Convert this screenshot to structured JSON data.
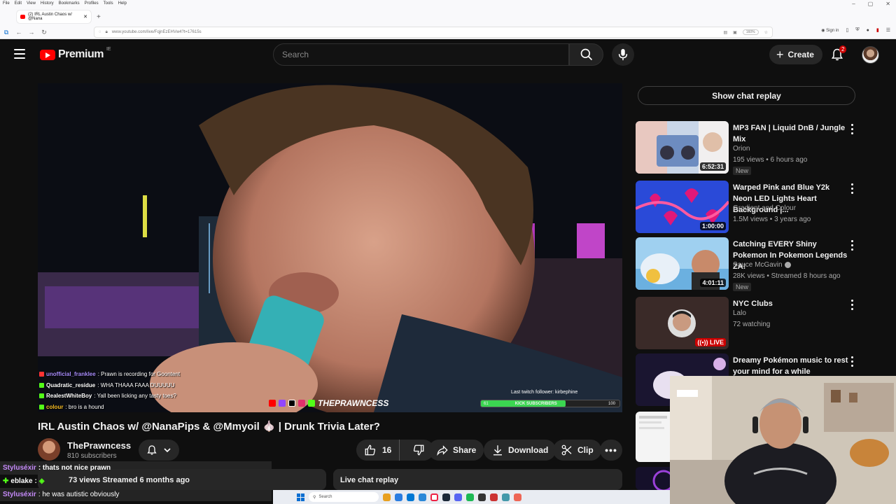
{
  "browser": {
    "menu": [
      "File",
      "Edit",
      "View",
      "History",
      "Bookmarks",
      "Profiles",
      "Tools",
      "Help"
    ],
    "tab_title": "(2) IRL Austin Chaos w/ @Nana",
    "url": "www.youtube.com/live/FqjnEzEHVw4?t=17615s",
    "zoom": "160%",
    "signin": "Sign in"
  },
  "header": {
    "logo_text": "Premium",
    "country": "IE",
    "search_placeholder": "Search",
    "create_label": "Create",
    "notif_count": "2"
  },
  "player": {
    "chat_overlay": [
      {
        "user": "unofficial_franklee",
        "msg": ": Prawn is recording for Goontent"
      },
      {
        "user": "Quadratic_residue",
        "msg": ": WHA THAAA FAAA DUUUUU"
      },
      {
        "user": "RealestWhiteBoy",
        "msg": ": Yall been licking any tasty toes?"
      },
      {
        "user": "colour",
        "msg": ": bro is a hound"
      }
    ],
    "brand": "THEPRAWNCESS",
    "follower_text": "Last twitch follower: kirbephine",
    "sub_bar": {
      "left": "61",
      "label": "KICK SUBSCRIBERS",
      "right": "100",
      "progress": 0.61
    }
  },
  "video": {
    "title": "IRL Austin Chaos w/ @NanaPips & @Mmyoil 🧄 | Drunk Trivia Later?",
    "channel": "ThePrawncess",
    "subscribers": "810 subscribers",
    "likes": "16",
    "share": "Share",
    "download": "Download",
    "clip": "Clip",
    "meta": "73 views  Streamed 6 months ago",
    "live_chat_replay": "Live chat replay"
  },
  "obs_chat": [
    {
      "user": "Styluséxir",
      "msg": ": thats not nice prawn"
    },
    {
      "user": "eblake",
      "msg": ":"
    },
    {
      "user": "Styluséxir",
      "msg": ": he was autistic obviously"
    }
  ],
  "sidebar": {
    "show_chat": "Show chat replay",
    "items": [
      {
        "title": "MP3 FAN | Liquid DnB / Jungle Mix",
        "channel": "Orion",
        "stats": "195 views • 6 hours ago",
        "badge": "New",
        "duration": "6:52:31"
      },
      {
        "title": "Warped Pink and Blue Y2k Neon LED Lights Heart Background |...",
        "channel": "Gradient and Colour",
        "stats": "1.5M views • 3 years ago",
        "duration": "1:00:00"
      },
      {
        "title": "Catching EVERY Shiny Pokemon In Pokemon Legends ZA!",
        "channel": "Sauce McGavin",
        "stats": "28K views • Streamed 8 hours ago",
        "badge": "New",
        "duration": "4:01:11"
      },
      {
        "title": "NYC Clubs",
        "channel": "Lalo",
        "stats": "72 watching",
        "live": "LIVE"
      },
      {
        "title": "Dreamy Pokémon music to rest your mind for a while"
      }
    ]
  },
  "taskbar": {
    "search": "Search"
  },
  "colors": {
    "accent": "#ff0000",
    "bg": "#0f0f0f",
    "pill": "#272727"
  }
}
